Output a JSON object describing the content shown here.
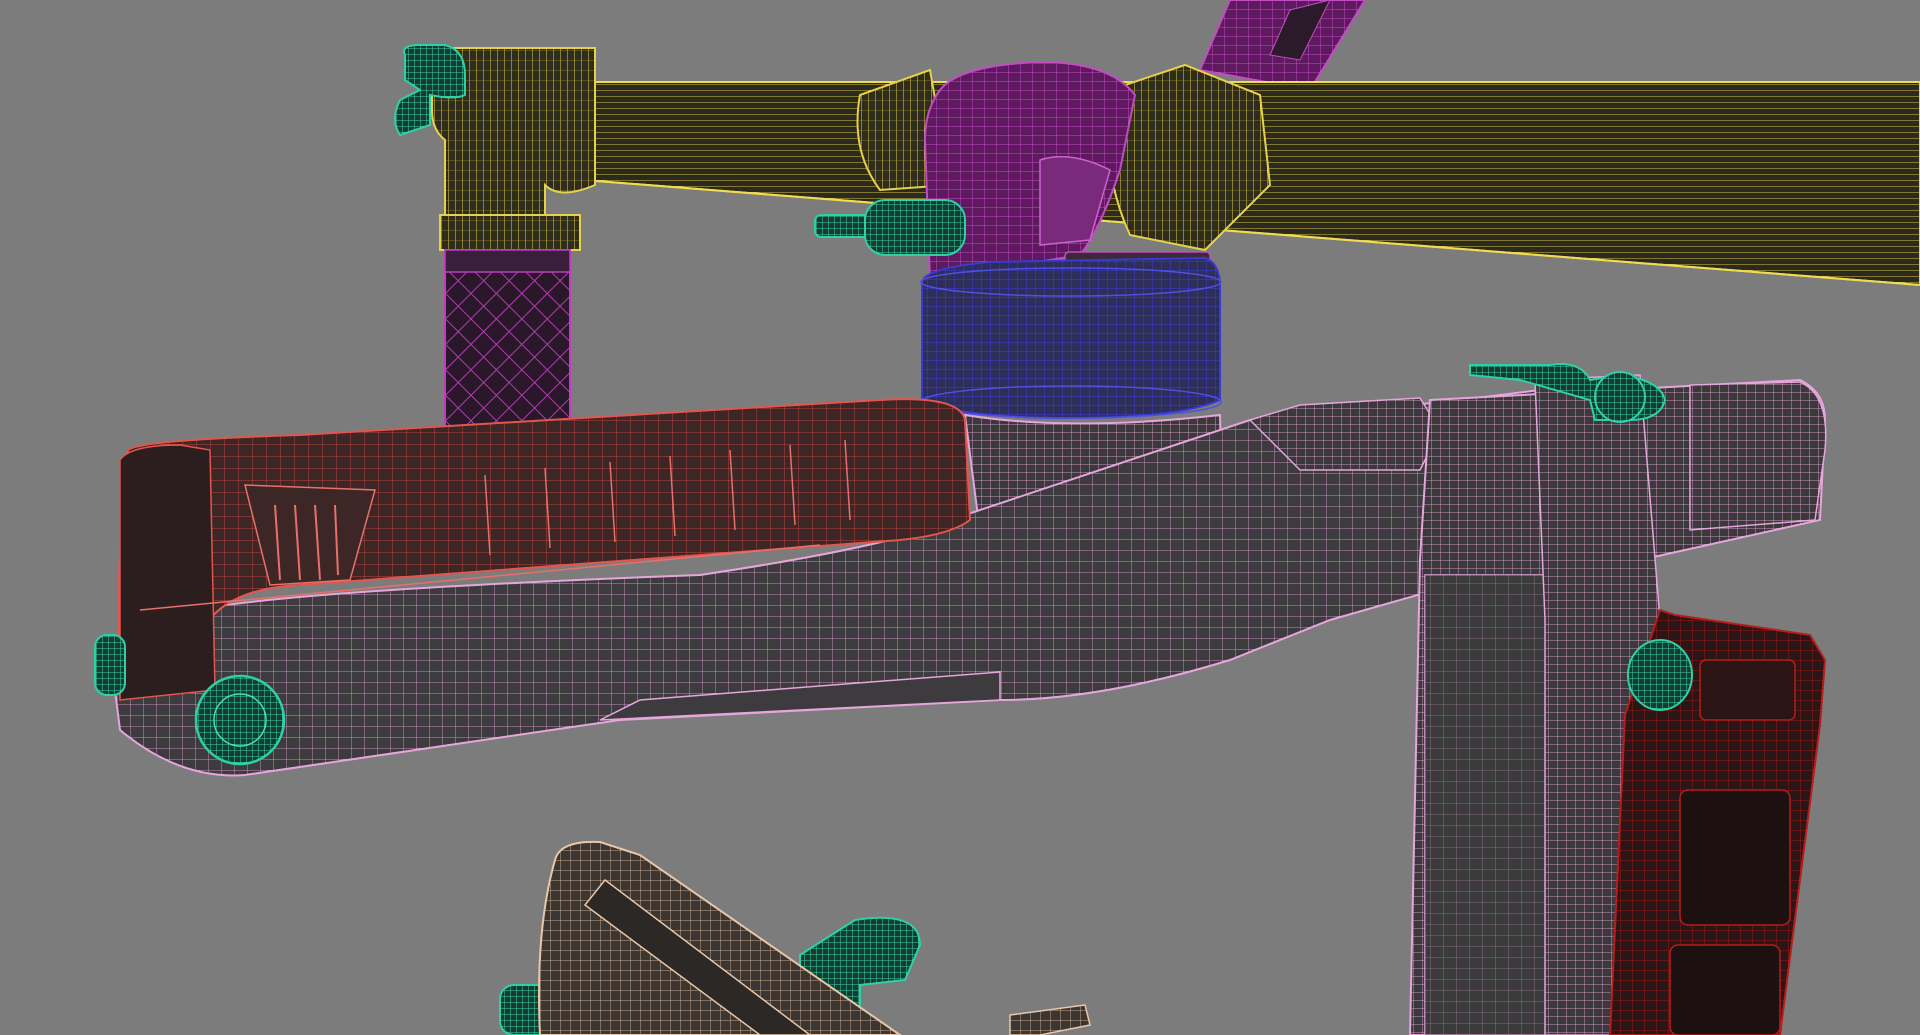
{
  "scene": {
    "kind": "3d-viewport-wireframe",
    "background_color": "#7c7c7c",
    "objects": [
      {
        "name": "handlebar-tube",
        "wire_color": "#e6d24a",
        "fill_color": "#2b2a1c"
      },
      {
        "name": "handlebar-clamp-rings",
        "wire_color": "#e6d24a",
        "fill_color": "#2e2c1a"
      },
      {
        "name": "handle-grip-left",
        "wire_color": "#c03cc0",
        "fill_color": "#2a1a2a"
      },
      {
        "name": "center-hub-clamp",
        "wire_color": "#b43cb4",
        "fill_color": "#6a1c6a"
      },
      {
        "name": "motor-housing",
        "wire_color": "#3a3ad2",
        "fill_color": "#2c2c56"
      },
      {
        "name": "battery-pack",
        "wire_color": "#e2564e",
        "fill_color": "#3a2424"
      },
      {
        "name": "gimbal-arm",
        "wire_color": "#e6a6dc",
        "fill_color": "#3a3a3a"
      },
      {
        "name": "control-box",
        "wire_color": "#b81c1c",
        "fill_color": "#2a1414"
      },
      {
        "name": "knobs-and-levers",
        "wire_color": "#2fd0a6",
        "fill_color": "#1c3a30"
      },
      {
        "name": "lower-clamp",
        "wire_color": "#e8c7a8",
        "fill_color": "#3a3430"
      }
    ]
  }
}
